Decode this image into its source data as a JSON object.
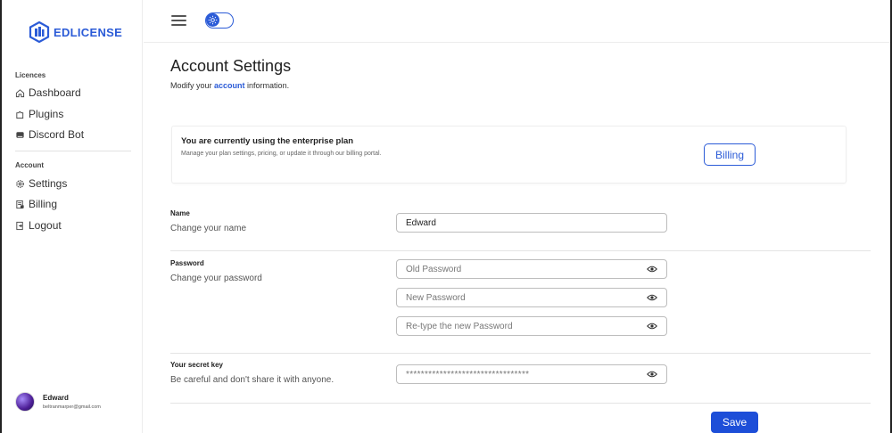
{
  "brand": {
    "name": "EDLICENSE",
    "accent": "#2b5bd7"
  },
  "sidebar": {
    "sections": [
      {
        "label": "Licences"
      },
      {
        "label": "Account"
      }
    ],
    "licences_items": [
      {
        "label": "Dashboard",
        "icon": "home-icon"
      },
      {
        "label": "Plugins",
        "icon": "puzzle-icon"
      },
      {
        "label": "Discord Bot",
        "icon": "discord-icon"
      }
    ],
    "account_items": [
      {
        "label": "Settings",
        "icon": "gear-icon"
      },
      {
        "label": "Billing",
        "icon": "receipt-icon"
      },
      {
        "label": "Logout",
        "icon": "logout-icon"
      }
    ],
    "user": {
      "name": "Edward",
      "email": "beltranmarper@gmail.com"
    }
  },
  "topbar": {
    "menu_icon": "hamburger-icon",
    "theme_icon": "sun-icon"
  },
  "main": {
    "title": "Account Settings",
    "subtitle_prefix": "Modify your ",
    "subtitle_highlight": "account",
    "subtitle_suffix": " information.",
    "plan": {
      "title": "You are currently using the enterprise plan",
      "description": "Manage your plan settings, pricing, or update it through our billing portal.",
      "billing_button": "Billing"
    },
    "name_field": {
      "label": "Name",
      "help": "Change your name",
      "value": "Edward"
    },
    "password_field": {
      "label": "Password",
      "help": "Change your password",
      "old_placeholder": "Old Password",
      "new_placeholder": "New Password",
      "retype_placeholder": "Re-type the new Password"
    },
    "secret_field": {
      "label": "Your secret key",
      "help": "Be careful and don't share it with anyone.",
      "value": "*********************************"
    },
    "save_button": "Save"
  }
}
